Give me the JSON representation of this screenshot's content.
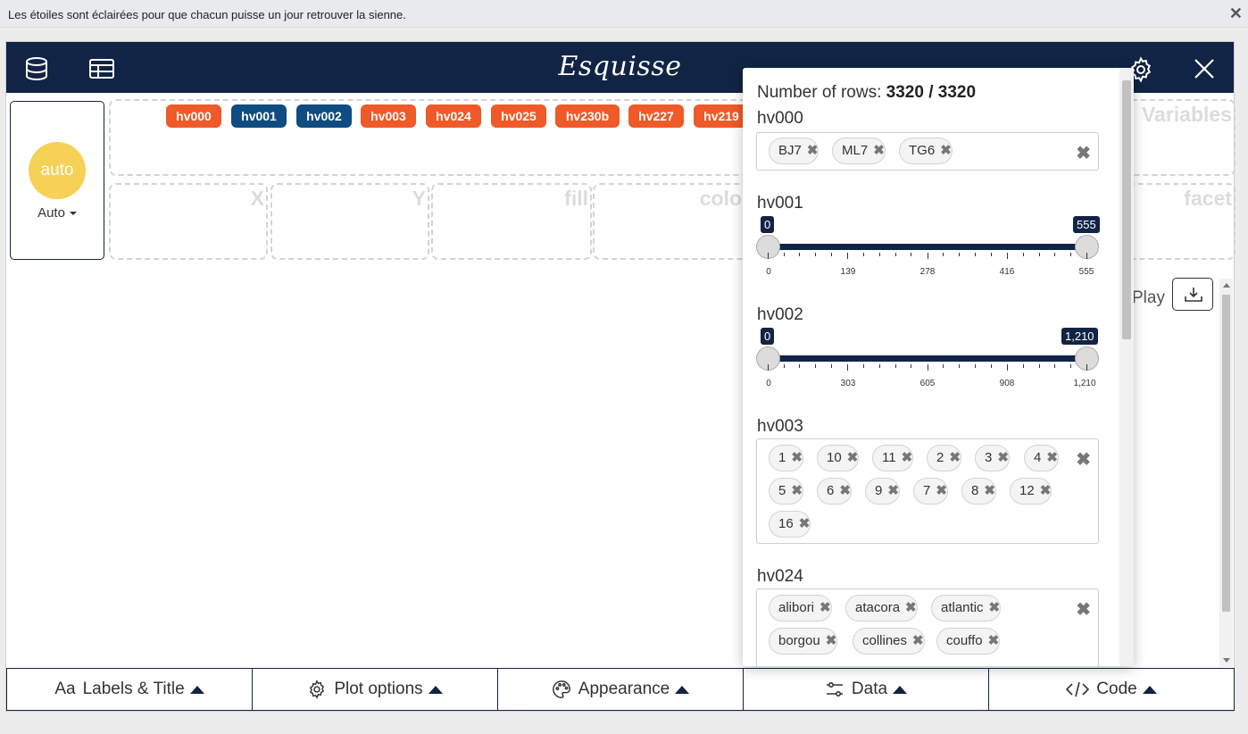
{
  "notice": {
    "text": "Les étoiles sont éclairées pour que chacun puisse un jour retrouver la sienne.",
    "close": "✕"
  },
  "app": {
    "title": "Esquisse",
    "header_color": "#112446"
  },
  "geom": {
    "circle_label": "auto",
    "dropdown_label": "Auto",
    "circle_color": "#f5d155"
  },
  "zones": {
    "variables": "Variables",
    "x": "X",
    "y": "Y",
    "fill": "fill",
    "color": "color",
    "facet": "facet"
  },
  "badges": [
    {
      "label": "hv000",
      "color": "#ef5a28"
    },
    {
      "label": "hv001",
      "color": "#0f4c81"
    },
    {
      "label": "hv002",
      "color": "#0f4c81"
    },
    {
      "label": "hv003",
      "color": "#ef5a28"
    },
    {
      "label": "hv024",
      "color": "#ef5a28"
    },
    {
      "label": "hv025",
      "color": "#ef5a28"
    },
    {
      "label": "hv230b",
      "color": "#ef5a28"
    },
    {
      "label": "hv227",
      "color": "#ef5a28"
    },
    {
      "label": "hv219",
      "color": "#ef5a28"
    }
  ],
  "play_label": "Play",
  "toolbar": {
    "labels_title": "Labels & Title",
    "plot_options": "Plot options",
    "appearance": "Appearance",
    "data": "Data",
    "code": "Code",
    "aa": "Aa"
  },
  "filter_panel": {
    "rows_label": "Number of rows:",
    "rows_value": "3320 / 3320",
    "hv000": {
      "label": "hv000",
      "tags": [
        "BJ7",
        "ML7",
        "TG6"
      ]
    },
    "hv001": {
      "label": "hv001",
      "min": "0",
      "max": "555",
      "ticks": [
        "0",
        "139",
        "278",
        "416",
        "555"
      ]
    },
    "hv002": {
      "label": "hv002",
      "min": "0",
      "max": "1,210",
      "ticks": [
        "0",
        "303",
        "605",
        "908",
        "1,210"
      ]
    },
    "hv003": {
      "label": "hv003",
      "tags": [
        "1",
        "10",
        "11",
        "2",
        "3",
        "4",
        "5",
        "6",
        "9",
        "7",
        "8",
        "12",
        "16"
      ]
    },
    "hv024": {
      "label": "hv024",
      "tags": [
        "alibori",
        "atacora",
        "atlantic",
        "borgou",
        "collines",
        "couffo"
      ]
    },
    "clear_symbol": "✖",
    "tag_remove": "✖"
  }
}
